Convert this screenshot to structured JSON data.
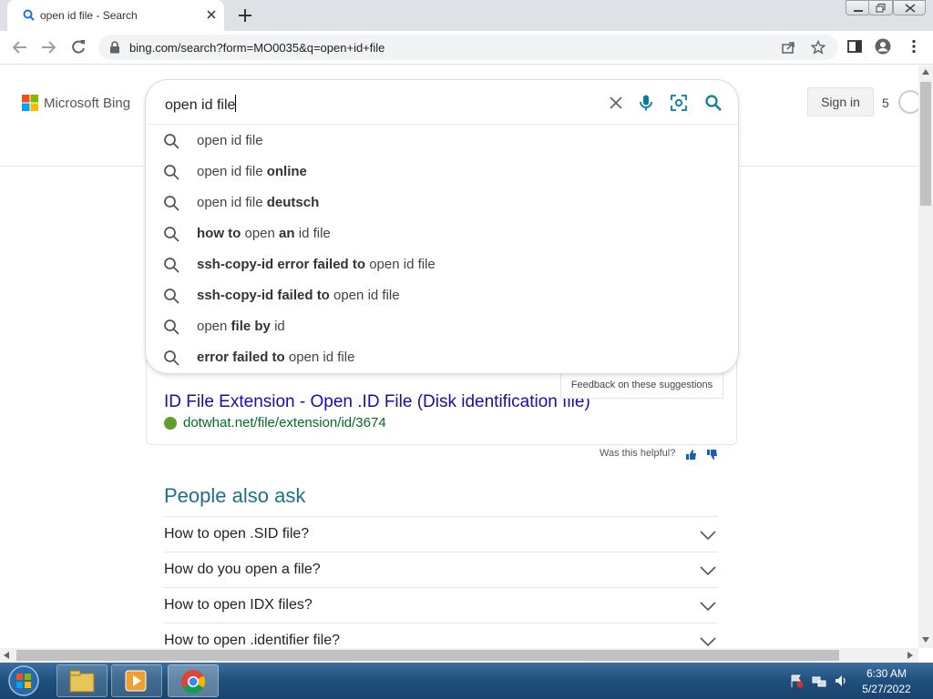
{
  "browser": {
    "tab_title": "open id file - Search",
    "url": "bing.com/search?form=MO0035&q=open+id+file"
  },
  "bing": {
    "logo_text": "Microsoft Bing",
    "search_query": "open id file",
    "sign_in": "Sign in",
    "rewards_count": "5",
    "suggestions": [
      {
        "parts": [
          {
            "t": "open id file",
            "b": false
          }
        ]
      },
      {
        "parts": [
          {
            "t": "open id file ",
            "b": false
          },
          {
            "t": "online",
            "b": true
          }
        ]
      },
      {
        "parts": [
          {
            "t": "open id file ",
            "b": false
          },
          {
            "t": "deutsch",
            "b": true
          }
        ]
      },
      {
        "parts": [
          {
            "t": "how to",
            "b": true
          },
          {
            "t": " open ",
            "b": false
          },
          {
            "t": "an",
            "b": true
          },
          {
            "t": " id file",
            "b": false
          }
        ]
      },
      {
        "parts": [
          {
            "t": "ssh-copy-id error failed to",
            "b": true
          },
          {
            "t": " open id file",
            "b": false
          }
        ]
      },
      {
        "parts": [
          {
            "t": "ssh-copy-id failed to",
            "b": true
          },
          {
            "t": " open id file",
            "b": false
          }
        ]
      },
      {
        "parts": [
          {
            "t": "open ",
            "b": false
          },
          {
            "t": "file by",
            "b": true
          },
          {
            "t": " id",
            "b": false
          }
        ]
      },
      {
        "parts": [
          {
            "t": "error failed to",
            "b": true
          },
          {
            "t": " open id file",
            "b": false
          }
        ]
      }
    ],
    "feedback": "Feedback on these suggestions",
    "result": {
      "title": "ID File Extension - Open .ID File (Disk identification file)",
      "url": "dotwhat.net/file/extension/id/3674"
    },
    "helpful": "Was this helpful?",
    "people_also_ask": {
      "heading": "People also ask",
      "questions": [
        "How to open .SID file?",
        "How do you open a file?",
        "How to open IDX files?",
        "How to open .identifier file?"
      ]
    }
  },
  "taskbar": {
    "time": "6:30 AM",
    "date": "5/27/2022"
  },
  "colors": {
    "link_title": "#1a0dab",
    "link_url": "#006d21",
    "paa_heading": "#1f6f8b",
    "bing_accent": "#00809d"
  }
}
